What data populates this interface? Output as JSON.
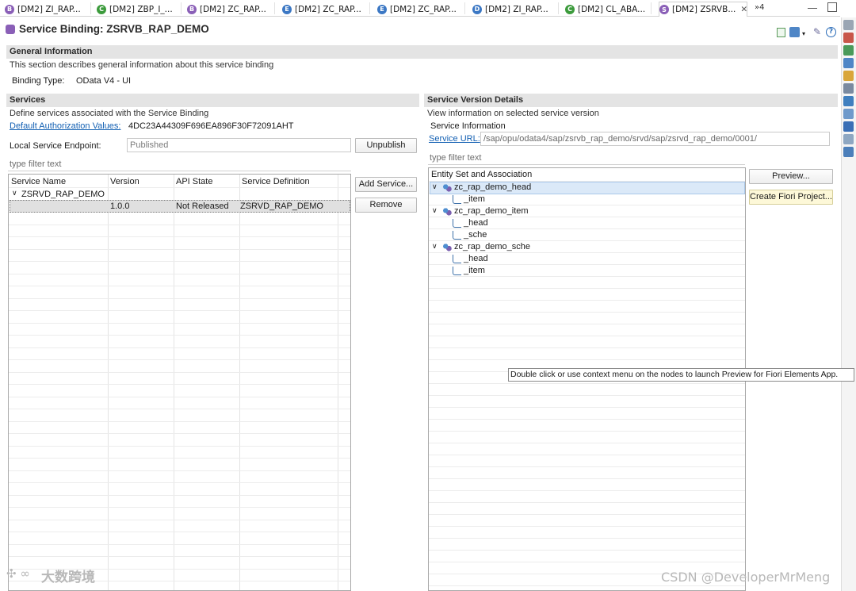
{
  "tabs": [
    {
      "label": "[DM2] ZI_RAP...",
      "icon": "interface-icon",
      "color": "#8a5fb7",
      "glyph": "B"
    },
    {
      "label": "[DM2] ZBP_I_...",
      "icon": "class-icon",
      "color": "#3c9b3c",
      "glyph": "C"
    },
    {
      "label": "[DM2] ZC_RAP...",
      "icon": "behavior-icon",
      "color": "#8a5fb7",
      "glyph": "B"
    },
    {
      "label": "[DM2] ZC_RAP...",
      "icon": "extension-icon",
      "color": "#3c78c4",
      "glyph": "E"
    },
    {
      "label": "[DM2] ZC_RAP...",
      "icon": "extension-icon",
      "color": "#3c78c4",
      "glyph": "E"
    },
    {
      "label": "[DM2] ZI_RAP...",
      "icon": "ddl-icon",
      "color": "#3c78c4",
      "glyph": "D"
    },
    {
      "label": "[DM2] CL_ABA...",
      "icon": "class-icon",
      "color": "#3c9b3c",
      "glyph": "C"
    },
    {
      "label": "[DM2] ZSRVB...",
      "icon": "service-binding-icon",
      "color": "#8a5fb7",
      "glyph": "S"
    }
  ],
  "tab_overflow": "»4",
  "editor_title": "Service Binding: ZSRVB_RAP_DEMO",
  "general": {
    "heading": "General Information",
    "description": "This section describes general information about this service binding",
    "binding_type_label": "Binding Type:",
    "binding_type_value": "OData V4 - UI"
  },
  "services": {
    "heading": "Services",
    "description": "Define services associated with the Service Binding",
    "auth_link": "Default Authorization Values:",
    "auth_value": "4DC23A44309F696EA896F30F72091AHT",
    "endpoint_label": "Local Service Endpoint:",
    "endpoint_value": "Published",
    "unpublish_button": "Unpublish",
    "filter_placeholder": "type filter text",
    "columns": [
      "Service Name",
      "Version",
      "API State",
      "Service Definition"
    ],
    "rows": [
      {
        "name": "ZSRVD_RAP_DEMO",
        "version": "",
        "state": "",
        "definition": ""
      },
      {
        "name": "",
        "version": "1.0.0",
        "state": "Not Released",
        "definition": "ZSRVD_RAP_DEMO"
      }
    ],
    "add_button": "Add Service...",
    "remove_button": "Remove"
  },
  "details": {
    "heading": "Service Version Details",
    "description": "View information on selected service version",
    "info_label": "Service Information",
    "url_link": "Service URL:",
    "url_value": "/sap/opu/odata4/sap/zsrvb_rap_demo/srvd/sap/zsrvd_rap_demo/0001/",
    "filter_placeholder": "type filter text",
    "tree_header": "Entity Set and Association",
    "tree": [
      {
        "label": "zc_rap_demo_head",
        "level": 0,
        "kind": "entity"
      },
      {
        "label": "_item",
        "level": 1,
        "kind": "association"
      },
      {
        "label": "zc_rap_demo_item",
        "level": 0,
        "kind": "entity"
      },
      {
        "label": "_head",
        "level": 1,
        "kind": "association"
      },
      {
        "label": "_sche",
        "level": 1,
        "kind": "association"
      },
      {
        "label": "zc_rap_demo_sche",
        "level": 0,
        "kind": "entity"
      },
      {
        "label": "_head",
        "level": 1,
        "kind": "association"
      },
      {
        "label": "_item",
        "level": 1,
        "kind": "association"
      }
    ],
    "preview_button": "Preview...",
    "fiori_button": "Create Fiori Project...",
    "tooltip": "Double click or use context menu on the nodes to launch Preview for Fiori Elements App."
  },
  "watermarks": {
    "left": "大数跨境",
    "right": "CSDN @DeveloperMrMeng"
  }
}
